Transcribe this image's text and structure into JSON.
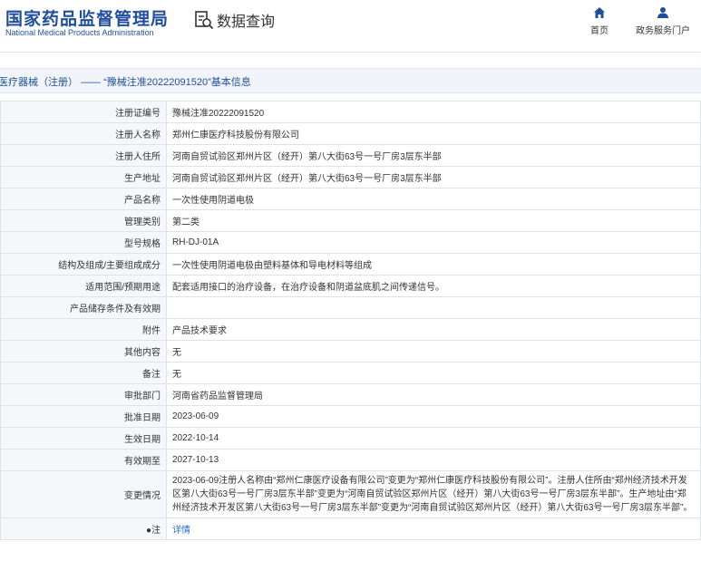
{
  "header": {
    "logo_cn": "国家药品监督管理局",
    "logo_en": "National Medical Products Administration",
    "query_title": "数据查询",
    "nav": [
      {
        "label": "首页",
        "icon": "home-icon"
      },
      {
        "label": "政务服务门户",
        "icon": "user-icon"
      }
    ]
  },
  "page_title": "医疗器械（注册） —— “豫械注准20222091520”基本信息",
  "colors": {
    "brand": "#1f4f9c",
    "link": "#1f6fd0",
    "label_bg": "#f5f7fa",
    "border": "#dde3ea"
  },
  "rows": [
    {
      "label": "注册证编号",
      "value": "豫械注准20222091520"
    },
    {
      "label": "注册人名称",
      "value": "郑州仁康医疗科技股份有限公司"
    },
    {
      "label": "注册人住所",
      "value": "河南自贸试验区郑州片区（经开）第八大街63号一号厂房3层东半部"
    },
    {
      "label": "生产地址",
      "value": "河南自贸试验区郑州片区（经开）第八大街63号一号厂房3层东半部"
    },
    {
      "label": "产品名称",
      "value": "一次性使用阴道电极"
    },
    {
      "label": "管理类别",
      "value": "第二类"
    },
    {
      "label": "型号规格",
      "value": "RH-DJ-01A"
    },
    {
      "label": "结构及组成/主要组成成分",
      "value": "一次性使用阴道电极由塑料基体和导电材料等组成"
    },
    {
      "label": "适用范围/预期用途",
      "value": "配套适用接口的治疗设备，在治疗设备和阴道盆底肌之间传递信号。"
    },
    {
      "label": "产品储存条件及有效期",
      "value": ""
    },
    {
      "label": "附件",
      "value": "产品技术要求"
    },
    {
      "label": "其他内容",
      "value": "无"
    },
    {
      "label": "备注",
      "value": "无"
    },
    {
      "label": "审批部门",
      "value": "河南省药品监督管理局"
    },
    {
      "label": "批准日期",
      "value": "2023-06-09"
    },
    {
      "label": "生效日期",
      "value": "2022-10-14"
    },
    {
      "label": "有效期至",
      "value": "2027-10-13"
    },
    {
      "label": "变更情况",
      "value": "2023-06-09注册人名称由“郑州仁康医疗设备有限公司”变更为“郑州仁康医疗科技股份有限公司”。注册人住所由“郑州经济技术开发区第八大街63号一号厂房3层东半部”变更为“河南自贸试验区郑州片区（经开）第八大街63号一号厂房3层东半部”。生产地址由“郑州经济技术开发区第八大街63号一号厂房3层东半部”变更为“河南自贸试验区郑州片区（经开）第八大街63号一号厂房3层东半部”。"
    }
  ],
  "note_row": {
    "label": "●注",
    "link": "详情"
  }
}
